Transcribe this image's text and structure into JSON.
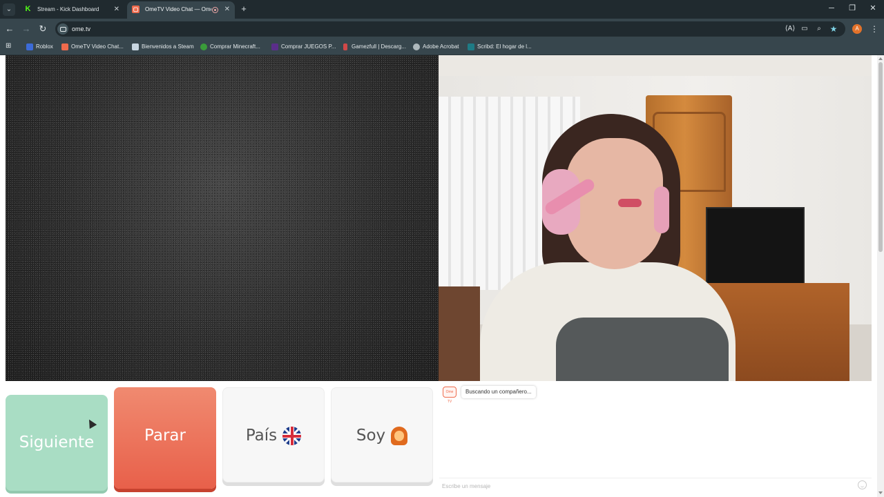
{
  "browser": {
    "tabs": [
      {
        "title": "Stream - Kick Dashboard",
        "favicon": "kick-icon",
        "active": false
      },
      {
        "title": "OmeTV Video Chat — Ome",
        "favicon": "ometv-icon",
        "active": true,
        "recording": true
      }
    ],
    "url": "ome.tv",
    "bookmarks": [
      {
        "label": "Roblox",
        "icon": "roblox-icon"
      },
      {
        "label": "OmeTV Video Chat...",
        "icon": "ometv-icon"
      },
      {
        "label": "Bienvenidos a Steam",
        "icon": "steam-icon"
      },
      {
        "label": "Comprar Minecraft...",
        "icon": "xbox-icon"
      },
      {
        "label": "Comprar JUEGOS P...",
        "icon": "game-icon"
      },
      {
        "label": "Gamezfull | Descarg...",
        "icon": "gamezfull-icon"
      },
      {
        "label": "Adobe Acrobat",
        "icon": "acrobat-icon"
      },
      {
        "label": "Scribd: El hogar de l...",
        "icon": "scribd-icon"
      }
    ],
    "profile_initial": "A"
  },
  "controls": {
    "next_label": "Siguiente",
    "stop_label": "Parar",
    "country_label": "País",
    "iam_label": "Soy"
  },
  "chat": {
    "status": "Buscando un compañero...",
    "input_placeholder": "Escribe un mensaje",
    "logo_text": "Ome TV"
  },
  "colors": {
    "next": "#a9ddc4",
    "stop": "#e8604a",
    "neutral": "#f7f7f7",
    "chrome_dark": "#202a2f",
    "chrome_toolbar": "#37464d"
  }
}
